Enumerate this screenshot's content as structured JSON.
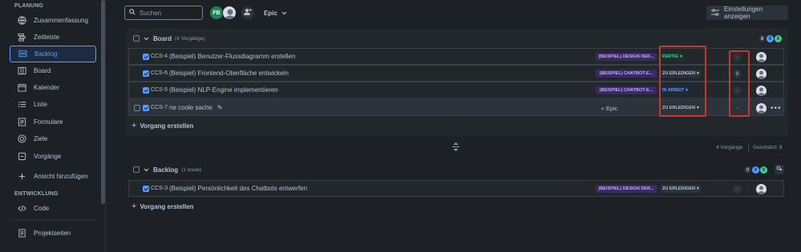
{
  "sidebar": {
    "sections": {
      "planning": "PLANUNG",
      "development": "ENTWICKLUNG"
    },
    "items": [
      {
        "label": "Zusammenfassung",
        "icon": "globe-icon"
      },
      {
        "label": "Zeitleiste",
        "icon": "timeline-icon"
      },
      {
        "label": "Backlog",
        "icon": "backlog-icon",
        "active": true
      },
      {
        "label": "Board",
        "icon": "board-icon"
      },
      {
        "label": "Kalender",
        "icon": "calendar-icon"
      },
      {
        "label": "Liste",
        "icon": "list-icon"
      },
      {
        "label": "Formulare",
        "icon": "form-icon"
      },
      {
        "label": "Ziele",
        "icon": "target-icon"
      },
      {
        "label": "Vorgänge",
        "icon": "issues-icon"
      },
      {
        "label": "Ansicht hinzufügen",
        "icon": "plus-icon"
      }
    ],
    "dev_items": [
      {
        "label": "Code",
        "icon": "code-icon"
      }
    ],
    "bottom_items": [
      {
        "label": "Projektseiten",
        "icon": "pages-icon"
      }
    ]
  },
  "toolbar": {
    "search_placeholder": "Suchen",
    "avatar_initials": "FB",
    "epic_filter": "Epic",
    "settings_label": "Einstellungen anzeigen"
  },
  "board": {
    "title": "Board",
    "count_label": "(4 Vorgänge)",
    "counts": {
      "grey": "8",
      "blue": "0",
      "green": "0"
    },
    "issues": [
      {
        "key": "CCS-4",
        "summary": "(Beispiel) Benutzer-Flussdiagramm erstellen",
        "epic": "(BEISPIEL) DESIGN DER...",
        "status": "FERTIG",
        "estimate": "-"
      },
      {
        "key": "CCS-6",
        "summary": "(Beispiel) Frontend-Oberfläche entwickeln",
        "epic": "(BEISPIEL) CHATBOT-E...",
        "status": "ZU ERLEDIGEN",
        "estimate": "8"
      },
      {
        "key": "CCS-5",
        "summary": "(Beispiel) NLP-Engine implementieren",
        "epic": "(BEISPIEL) CHATBOT-E...",
        "status": "IN ARBEIT",
        "estimate": "-"
      },
      {
        "key": "CCS-7",
        "summary": "ne coole sache",
        "epic_button": "+ Epic",
        "status": "ZU ERLEDIGEN",
        "estimate": "-"
      }
    ],
    "create_label": "Vorgang erstellen",
    "footer_count": "4 Vorgänge",
    "footer_estimate": "Geschätzt: 8"
  },
  "backlog": {
    "title": "Backlog",
    "count_label": "(1 issue)",
    "counts": {
      "grey": "0",
      "blue": "0",
      "green": "0"
    },
    "issues": [
      {
        "key": "CCS-3",
        "summary": "(Beispiel) Persönlichkeit des Chatbots entwerfen",
        "epic": "(BEISPIEL) DESIGN DER...",
        "status": "ZU ERLEDIGEN",
        "estimate": "-"
      }
    ],
    "create_label": "Vorgang erstellen"
  },
  "colors": {
    "accent": "#579dff",
    "done": "#4bce97",
    "highlight": "#c9372c",
    "epic_bg": "#352c63"
  }
}
